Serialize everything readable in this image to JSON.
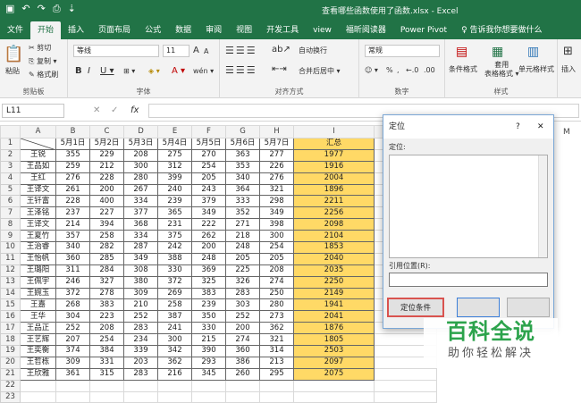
{
  "window": {
    "title": "查看哪些函数使用了函数.xlsx  -  Excel",
    "save_icon": "▣",
    "undo_icon": "↶",
    "redo_icon": "↷",
    "preview_icon": "⎙",
    "customize_icon": "⇣"
  },
  "tabs": [
    "文件",
    "开始",
    "插入",
    "页面布局",
    "公式",
    "数据",
    "审阅",
    "视图",
    "开发工具",
    "view",
    "福昕阅读器",
    "Power Pivot",
    "♀ 告诉我你想要做什么"
  ],
  "ribbon": {
    "clipboard": {
      "paste": "粘贴",
      "cut": "✂ 剪切",
      "copy": "⎘ 复制 ▾",
      "format_painter": "✎ 格式刷",
      "label": "剪贴板"
    },
    "font": {
      "name": "等线",
      "size": "11",
      "bold": "B",
      "italic": "I",
      "underline": "U ▾",
      "grow": "A",
      "shrink": "A",
      "border": "⊞ ▾",
      "fill": "◈ ▾",
      "color": "A ▾",
      "phonetic": "wén ▾",
      "label": "字体"
    },
    "alignment": {
      "wrap": "自动换行",
      "merge": "合并后居中 ▾",
      "label": "对齐方式"
    },
    "number": {
      "format": "常规",
      "currency": "☺ ▾",
      "percent": "%",
      "comma": ",",
      "inc": "←.0",
      "dec": ".00",
      "label": "数字"
    },
    "styles": {
      "conditional": "条件格式",
      "table": "套用\n表格格式 ▾",
      "cell": "单元格样式",
      "label": "样式"
    },
    "cells": {
      "insert": "插入"
    }
  },
  "formula": {
    "namebox": "L11",
    "cancel": "✕",
    "enter": "✓",
    "fx": "fx",
    "value": ""
  },
  "columns": [
    "",
    "A",
    "B",
    "C",
    "D",
    "E",
    "F",
    "G",
    "H",
    "I"
  ],
  "header_row": [
    "",
    "5月1日",
    "5月2日",
    "5月3日",
    "5月4日",
    "5月5日",
    "5月6日",
    "5月7日",
    "汇总"
  ],
  "rows": [
    [
      "王锐",
      "355",
      "229",
      "208",
      "275",
      "270",
      "363",
      "277",
      "1977"
    ],
    [
      "王品如",
      "259",
      "212",
      "300",
      "312",
      "254",
      "353",
      "226",
      "1916"
    ],
    [
      "王红",
      "276",
      "228",
      "280",
      "399",
      "205",
      "340",
      "276",
      "2004"
    ],
    [
      "王译文",
      "261",
      "200",
      "267",
      "240",
      "243",
      "364",
      "321",
      "1896"
    ],
    [
      "王钎富",
      "228",
      "400",
      "334",
      "239",
      "379",
      "333",
      "298",
      "2211"
    ],
    [
      "王泽铭",
      "237",
      "227",
      "377",
      "365",
      "349",
      "352",
      "349",
      "2256"
    ],
    [
      "王译文",
      "214",
      "394",
      "368",
      "231",
      "222",
      "271",
      "398",
      "2098"
    ],
    [
      "王夏竹",
      "357",
      "258",
      "334",
      "375",
      "262",
      "218",
      "300",
      "2104"
    ],
    [
      "王治睿",
      "340",
      "282",
      "287",
      "242",
      "200",
      "248",
      "254",
      "1853"
    ],
    [
      "王怡帆",
      "360",
      "285",
      "349",
      "388",
      "248",
      "205",
      "205",
      "2040"
    ],
    [
      "王璐阳",
      "311",
      "284",
      "308",
      "330",
      "369",
      "225",
      "208",
      "2035"
    ],
    [
      "王佩宇",
      "246",
      "327",
      "380",
      "372",
      "325",
      "326",
      "274",
      "2250"
    ],
    [
      "王婉玉",
      "372",
      "278",
      "309",
      "269",
      "383",
      "283",
      "250",
      "2149"
    ],
    [
      "王嘉",
      "268",
      "383",
      "210",
      "258",
      "239",
      "303",
      "280",
      "1941"
    ],
    [
      "王华",
      "304",
      "223",
      "252",
      "387",
      "350",
      "252",
      "273",
      "2041"
    ],
    [
      "王品正",
      "252",
      "208",
      "283",
      "241",
      "330",
      "200",
      "362",
      "1876"
    ],
    [
      "王艺辉",
      "207",
      "254",
      "234",
      "300",
      "215",
      "274",
      "321",
      "1805"
    ],
    [
      "王奕衡",
      "374",
      "384",
      "339",
      "342",
      "390",
      "360",
      "314",
      "2503"
    ],
    [
      "王哲栋",
      "309",
      "331",
      "203",
      "362",
      "293",
      "386",
      "213",
      "2097"
    ],
    [
      "王欣雅",
      "361",
      "315",
      "283",
      "216",
      "345",
      "260",
      "295",
      "2075"
    ]
  ],
  "extra_rows": [
    "22",
    "23"
  ],
  "dialog": {
    "title": "定位",
    "help": "?",
    "close": "✕",
    "goto_label": "定位:",
    "ref_label": "引用位置(R):",
    "special_btn": "定位条件",
    "ok_btn": "",
    "cancel_btn": "",
    "m_label": "M"
  },
  "watermark": {
    "line1": "百科全说",
    "line2": "助你轻松解决"
  },
  "colors": {
    "excel_green": "#217346",
    "sum_fill": "#ffd966",
    "watermark_green": "#2ca34c"
  }
}
